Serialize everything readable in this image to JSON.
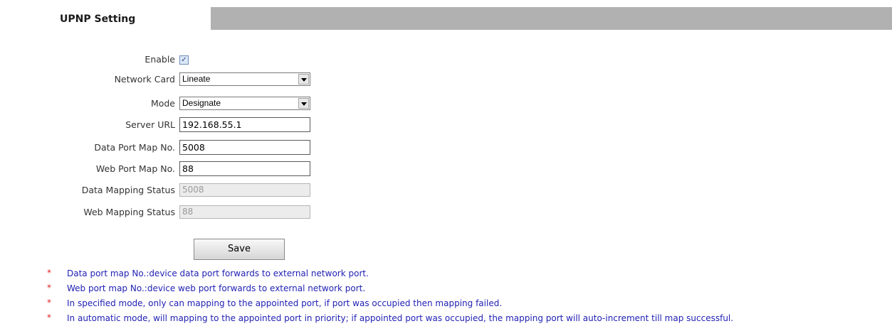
{
  "tab": {
    "title": "UPNP Setting"
  },
  "form": {
    "enable": {
      "label": "Enable",
      "checked": true,
      "check_glyph": "✓"
    },
    "network_card": {
      "label": "Network Card",
      "value": "Lineate"
    },
    "mode": {
      "label": "Mode",
      "value": "Designate"
    },
    "server_url": {
      "label": "Server URL",
      "value": "192.168.55.1"
    },
    "data_port": {
      "label": "Data Port Map No.",
      "value": "5008"
    },
    "web_port": {
      "label": "Web Port Map No.",
      "value": "88"
    },
    "data_status": {
      "label": "Data Mapping Status",
      "value": "5008"
    },
    "web_status": {
      "label": "Web Mapping Status",
      "value": "88"
    }
  },
  "actions": {
    "save_label": "Save"
  },
  "notes": {
    "marker": "*",
    "items": [
      "Data port map No.:device data port forwards to external network port.",
      "Web port map No.:device web port forwards to external network port.",
      "In specified mode, only can mapping to the appointed port, if port was occupied then mapping failed.",
      "In automatic mode, will mapping to the appointed port in priority; if appointed port was occupied, the mapping port will auto-increment till map successful."
    ]
  },
  "colors": {
    "tab_bar": "#b1b1b1",
    "note_text": "#1f1fb4",
    "note_marker": "#e02020"
  }
}
